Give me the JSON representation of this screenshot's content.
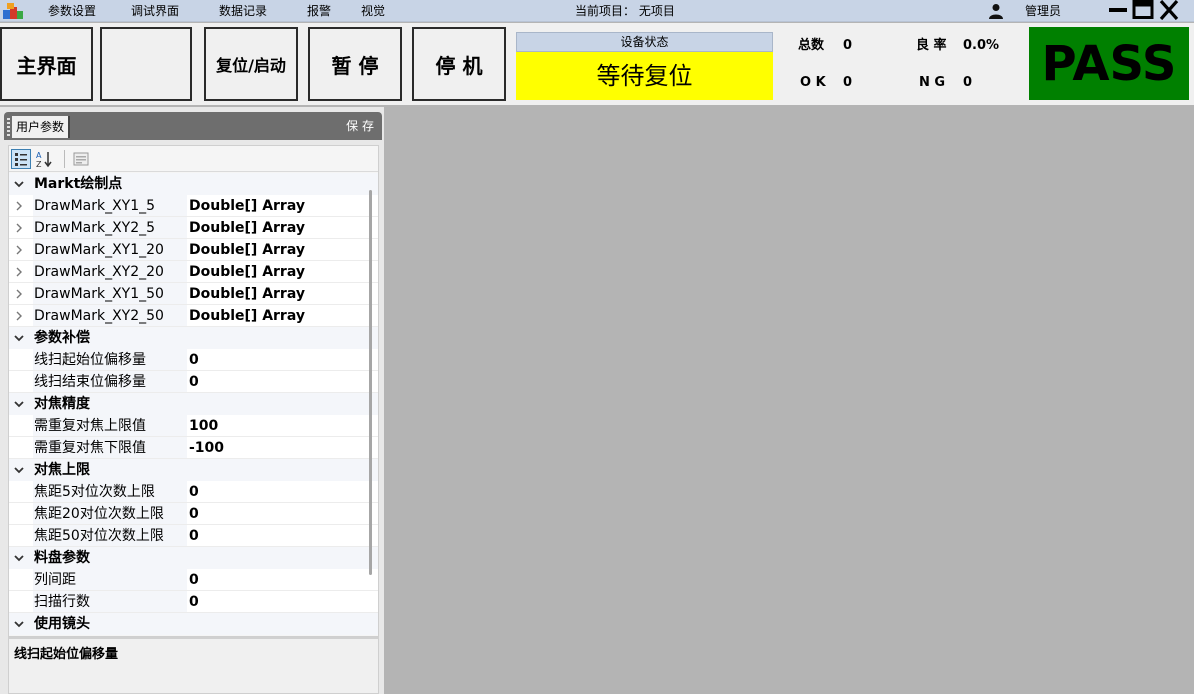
{
  "menubar": {
    "items": [
      "参数设置",
      "调试界面",
      "数据记录",
      "报警",
      "视觉"
    ],
    "project_label": "当前项目： 无项目",
    "user_name": "管理员"
  },
  "header": {
    "buttons": [
      "主界面",
      "",
      "复位/启动",
      "暂 停",
      "停 机"
    ],
    "status_title": "设备状态",
    "status_value": "等待复位",
    "status_color": "#ffff00",
    "stats": {
      "total_label": "总数",
      "total_value": "0",
      "rate_label": "良 率",
      "rate_value": "0.0%",
      "ok_label": "O K",
      "ok_value": "0",
      "ng_label": "N G",
      "ng_value": "0"
    },
    "result": "PASS",
    "result_color": "#008000"
  },
  "panel": {
    "tab_label": "用户参数",
    "save_label": "保 存",
    "rows": [
      {
        "type": "cat",
        "name": "Markt绘制点"
      },
      {
        "type": "prop",
        "name": "DrawMark_XY1_5",
        "value": "Double[] Array",
        "expandable": true
      },
      {
        "type": "prop",
        "name": "DrawMark_XY2_5",
        "value": "Double[] Array",
        "expandable": true
      },
      {
        "type": "prop",
        "name": "DrawMark_XY1_20",
        "value": "Double[] Array",
        "expandable": true
      },
      {
        "type": "prop",
        "name": "DrawMark_XY2_20",
        "value": "Double[] Array",
        "expandable": true
      },
      {
        "type": "prop",
        "name": "DrawMark_XY1_50",
        "value": "Double[] Array",
        "expandable": true
      },
      {
        "type": "prop",
        "name": "DrawMark_XY2_50",
        "value": "Double[] Array",
        "expandable": true
      },
      {
        "type": "cat",
        "name": "参数补偿"
      },
      {
        "type": "prop",
        "name": "线扫起始位偏移量",
        "value": "0"
      },
      {
        "type": "prop",
        "name": "线扫结束位偏移量",
        "value": "0"
      },
      {
        "type": "cat",
        "name": "对焦精度"
      },
      {
        "type": "prop",
        "name": "需重复对焦上限值",
        "value": "100"
      },
      {
        "type": "prop",
        "name": "需重复对焦下限值",
        "value": "-100"
      },
      {
        "type": "cat",
        "name": "对焦上限"
      },
      {
        "type": "prop",
        "name": "焦距5对位次数上限",
        "value": "0"
      },
      {
        "type": "prop",
        "name": "焦距20对位次数上限",
        "value": "0"
      },
      {
        "type": "prop",
        "name": "焦距50对位次数上限",
        "value": "0"
      },
      {
        "type": "cat",
        "name": "料盘参数"
      },
      {
        "type": "prop",
        "name": "列间距",
        "value": "0"
      },
      {
        "type": "prop",
        "name": "扫描行数",
        "value": "0"
      },
      {
        "type": "cat",
        "name": "使用镜头"
      }
    ],
    "description": "线扫起始位偏移量"
  },
  "icons": {
    "app_logo": "app-logo-icon",
    "user": "user-icon",
    "minimize": "minimize-icon",
    "maximize": "maximize-icon",
    "close": "close-icon",
    "categorized": "categorized-view-icon",
    "alphabetical": "alphabetical-sort-icon",
    "property_pages": "property-pages-icon"
  }
}
